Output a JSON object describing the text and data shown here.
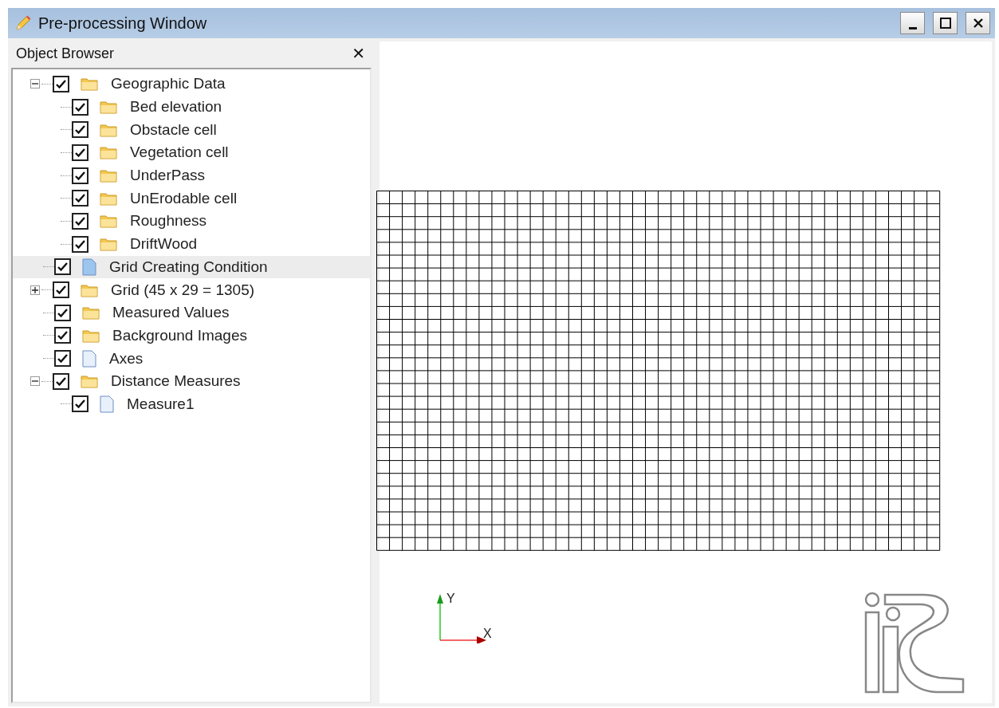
{
  "window": {
    "title": "Pre-processing Window"
  },
  "object_browser": {
    "title": "Object Browser",
    "close": "✕",
    "items": [
      {
        "label": "Geographic Data",
        "kind": "folder",
        "checked": true,
        "expanded": true,
        "selected": false,
        "children": [
          {
            "label": "Bed elevation",
            "kind": "folder",
            "checked": true,
            "selected": false
          },
          {
            "label": "Obstacle cell",
            "kind": "folder",
            "checked": true,
            "selected": false
          },
          {
            "label": "Vegetation cell",
            "kind": "folder",
            "checked": true,
            "selected": false
          },
          {
            "label": "UnderPass",
            "kind": "folder",
            "checked": true,
            "selected": false
          },
          {
            "label": "UnErodable cell",
            "kind": "folder",
            "checked": true,
            "selected": false
          },
          {
            "label": "Roughness",
            "kind": "folder",
            "checked": true,
            "selected": false
          },
          {
            "label": "DriftWood",
            "kind": "folder",
            "checked": true,
            "selected": false
          }
        ]
      },
      {
        "label": "Grid Creating Condition",
        "kind": "sheet-blue",
        "checked": true,
        "selected": true
      },
      {
        "label": "Grid (45 x 29 = 1305)",
        "kind": "folder",
        "checked": true,
        "expanded": false,
        "selected": false
      },
      {
        "label": "Measured Values",
        "kind": "folder",
        "checked": true,
        "selected": false
      },
      {
        "label": "Background Images",
        "kind": "folder",
        "checked": true,
        "selected": false
      },
      {
        "label": "Axes",
        "kind": "sheet",
        "checked": true,
        "selected": false
      },
      {
        "label": "Distance Measures",
        "kind": "folder",
        "checked": true,
        "expanded": true,
        "selected": false,
        "children": [
          {
            "label": "Measure1",
            "kind": "sheet",
            "checked": true,
            "selected": false
          }
        ]
      }
    ]
  },
  "canvas": {
    "axis_y": "Y",
    "axis_x": "X"
  }
}
